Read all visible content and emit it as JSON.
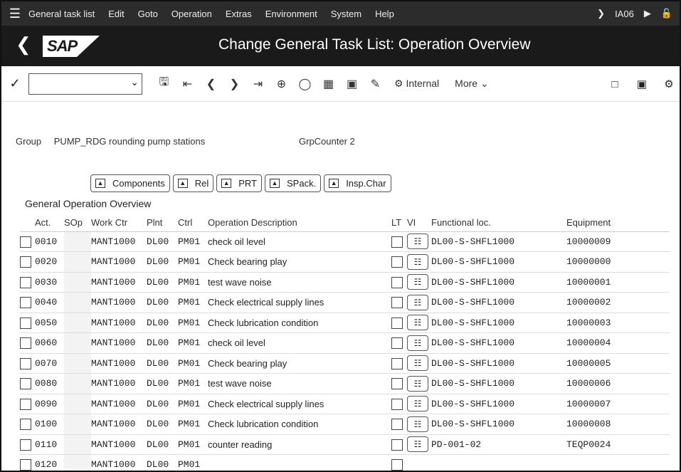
{
  "menu": {
    "items": [
      "General task list",
      "Edit",
      "Goto",
      "Operation",
      "Extras",
      "Environment",
      "System",
      "Help"
    ],
    "transaction": "IA06"
  },
  "title": "Change General Task List: Operation Overview",
  "logo_text": "SAP",
  "toolbar": {
    "internal_label": "Internal",
    "more_label": "More",
    "command_value": ""
  },
  "group": {
    "label": "Group",
    "value": "PUMP_RDG rounding pump stations",
    "counter_label": "GrpCounter",
    "counter_value": "2"
  },
  "buttons": [
    "Components",
    "Rel",
    "PRT",
    "SPack.",
    "Insp.Char"
  ],
  "section_title": "General Operation Overview",
  "table": {
    "headers": [
      "Act.",
      "SOp",
      "Work Ctr",
      "Plnt",
      "Ctrl",
      "Operation Description",
      "LT",
      "VI",
      "Functional loc.",
      "Equipment"
    ],
    "rows": [
      {
        "act": "0010",
        "wc": "MANT1000",
        "plnt": "DL00",
        "ctrl": "PM01",
        "desc": "check oil level",
        "fl": "DL00-S-SHFL1000",
        "eq": "10000009"
      },
      {
        "act": "0020",
        "wc": "MANT1000",
        "plnt": "DL00",
        "ctrl": "PM01",
        "desc": "Check bearing play",
        "fl": "DL00-S-SHFL1000",
        "eq": "10000000"
      },
      {
        "act": "0030",
        "wc": "MANT1000",
        "plnt": "DL00",
        "ctrl": "PM01",
        "desc": "test wave noise",
        "fl": "DL00-S-SHFL1000",
        "eq": "10000001"
      },
      {
        "act": "0040",
        "wc": "MANT1000",
        "plnt": "DL00",
        "ctrl": "PM01",
        "desc": "Check electrical supply lines",
        "fl": "DL00-S-SHFL1000",
        "eq": "10000002"
      },
      {
        "act": "0050",
        "wc": "MANT1000",
        "plnt": "DL00",
        "ctrl": "PM01",
        "desc": "Check lubrication condition",
        "fl": "DL00-S-SHFL1000",
        "eq": "10000003"
      },
      {
        "act": "0060",
        "wc": "MANT1000",
        "plnt": "DL00",
        "ctrl": "PM01",
        "desc": "check oil level",
        "fl": "DL00-S-SHFL1000",
        "eq": "10000004"
      },
      {
        "act": "0070",
        "wc": "MANT1000",
        "plnt": "DL00",
        "ctrl": "PM01",
        "desc": "Check bearing play",
        "fl": "DL00-S-SHFL1000",
        "eq": "10000005"
      },
      {
        "act": "0080",
        "wc": "MANT1000",
        "plnt": "DL00",
        "ctrl": "PM01",
        "desc": "test wave noise",
        "fl": "DL00-S-SHFL1000",
        "eq": "10000006"
      },
      {
        "act": "0090",
        "wc": "MANT1000",
        "plnt": "DL00",
        "ctrl": "PM01",
        "desc": "Check electrical supply lines",
        "fl": "DL00-S-SHFL1000",
        "eq": "10000007"
      },
      {
        "act": "0100",
        "wc": "MANT1000",
        "plnt": "DL00",
        "ctrl": "PM01",
        "desc": "Check lubrication condition",
        "fl": "DL00-S-SHFL1000",
        "eq": "10000008"
      },
      {
        "act": "0110",
        "wc": "MANT1000",
        "plnt": "DL00",
        "ctrl": "PM01",
        "desc": "counter reading",
        "fl": "PD-001-02",
        "eq": "TEQP0024"
      },
      {
        "act": "0120",
        "wc": "MANT1000",
        "plnt": "DL00",
        "ctrl": "PM01",
        "desc": "",
        "fl": "",
        "eq": ""
      }
    ]
  }
}
